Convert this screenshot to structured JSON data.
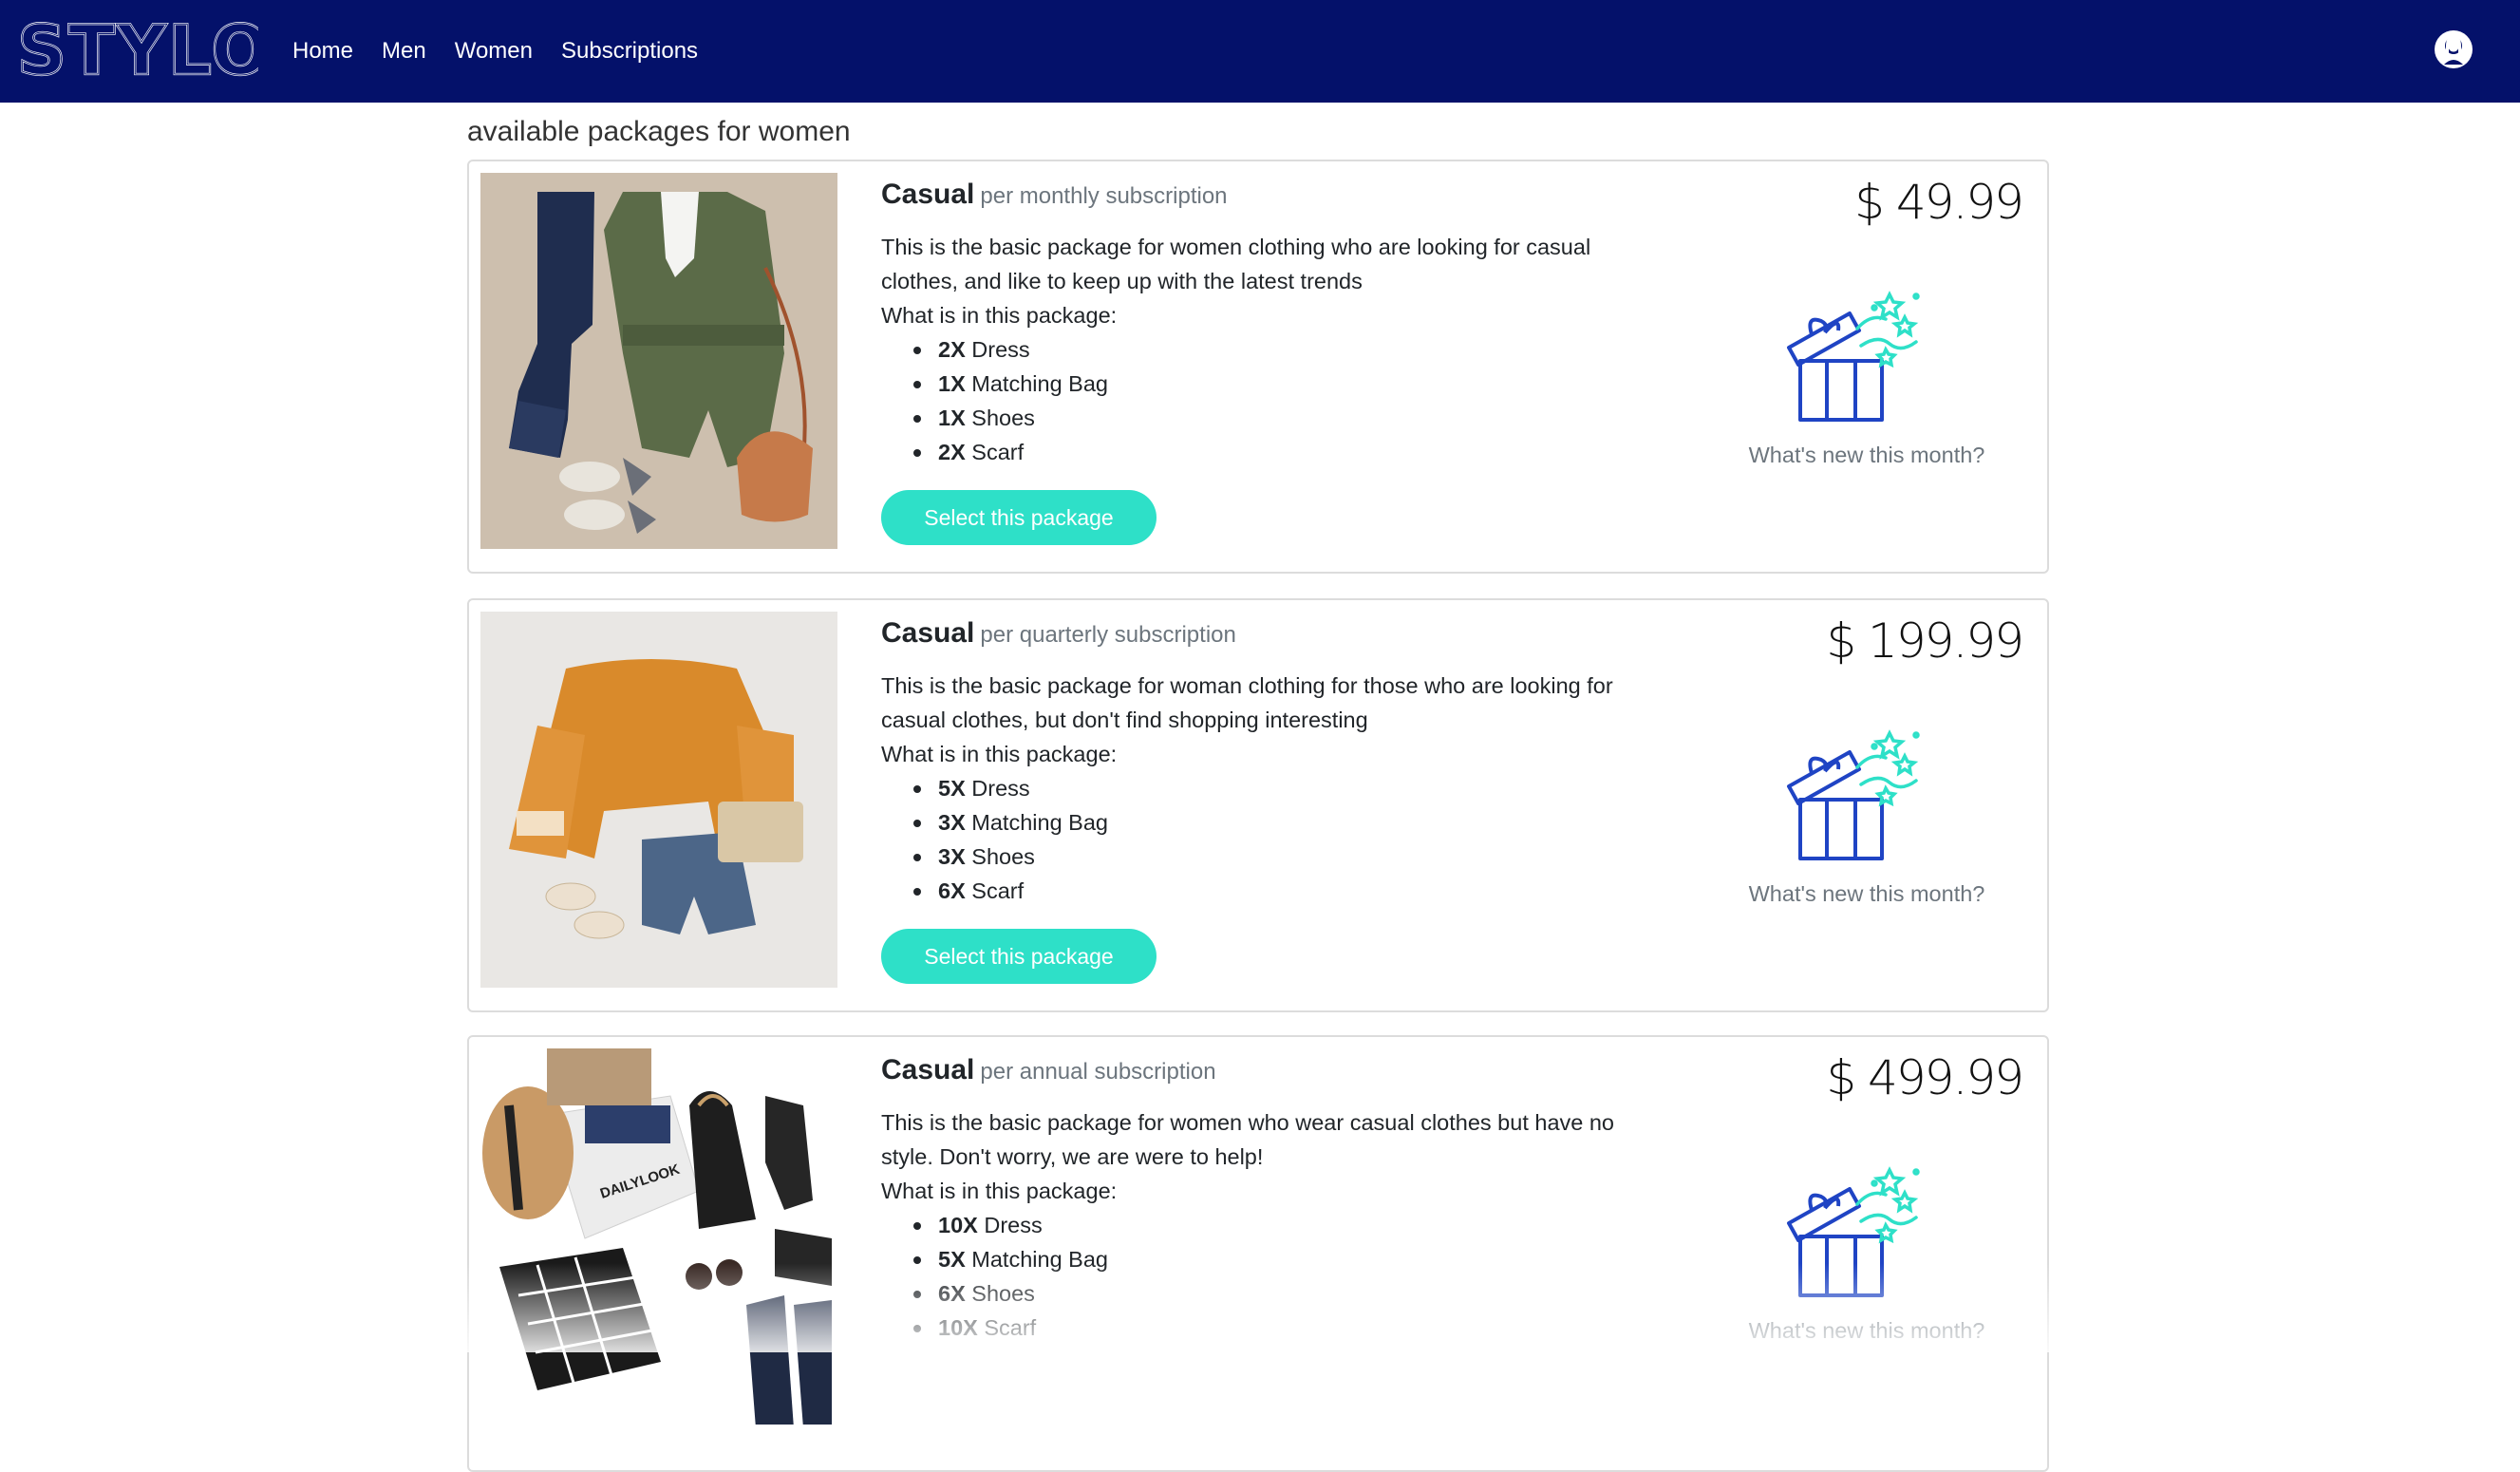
{
  "brand": {
    "logo_text": "STYLO"
  },
  "nav": {
    "links": [
      "Home",
      "Men",
      "Women",
      "Subscriptions"
    ]
  },
  "page": {
    "heading": "available packages for women"
  },
  "packages": [
    {
      "title": "Casual",
      "period": "per monthly subscription",
      "price": "$ 49.99",
      "description": "This is the basic package for women clothing who are looking for casual clothes, and like to keep up with the latest trends",
      "what_label": "What is in this package:",
      "items": [
        {
          "qty": "2X",
          "name": "Dress"
        },
        {
          "qty": "1X",
          "name": "Matching Bag"
        },
        {
          "qty": "1X",
          "name": "Shoes"
        },
        {
          "qty": "2X",
          "name": "Scarf"
        }
      ],
      "button": "Select this package",
      "whats_new": "What's new this month?"
    },
    {
      "title": "Casual",
      "period": "per quarterly subscription",
      "price": "$ 199.99",
      "description": "This is the basic package for woman clothing for those who are looking for casual clothes, but don't find shopping interesting",
      "what_label": "What is in this package:",
      "items": [
        {
          "qty": "5X",
          "name": "Dress"
        },
        {
          "qty": "3X",
          "name": "Matching Bag"
        },
        {
          "qty": "3X",
          "name": "Shoes"
        },
        {
          "qty": "6X",
          "name": "Scarf"
        }
      ],
      "button": "Select this package",
      "whats_new": "What's new this month?"
    },
    {
      "title": "Casual",
      "period": "per annual subscription",
      "price": "$ 499.99",
      "description": "This is the basic package for women who wear casual clothes but have no style. Don't worry, we are were to help!",
      "what_label": "What is in this package:",
      "items": [
        {
          "qty": "10X",
          "name": "Dress"
        },
        {
          "qty": "5X",
          "name": "Matching Bag"
        },
        {
          "qty": "6X",
          "name": "Shoes"
        },
        {
          "qty": "10X",
          "name": "Scarf"
        }
      ],
      "whats_new": "What's new this month?"
    }
  ],
  "image_labels": {
    "box_label": "DAILYLOOK"
  },
  "colors": {
    "navbar": "#04116a",
    "button": "#2ee0c8",
    "gift_blue": "#1f44c4",
    "gift_teal": "#2ee0c8"
  },
  "icons": [
    "user-icon",
    "gift-icon"
  ]
}
